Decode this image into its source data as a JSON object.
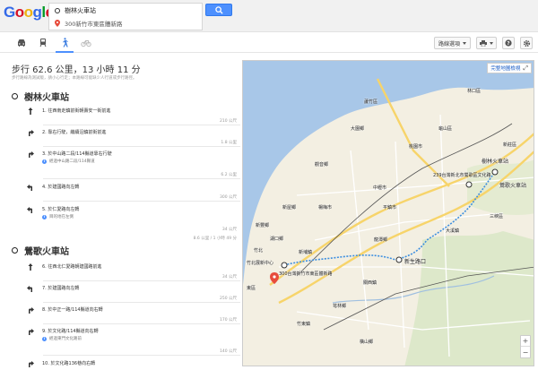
{
  "app": {
    "logo_text": "Google"
  },
  "directions": {
    "origin": "樹林火車站",
    "destination": "300新竹市東區體新路",
    "search_icon": "search-icon"
  },
  "modes": [
    {
      "name": "car-icon",
      "active": false
    },
    {
      "name": "transit-icon",
      "active": false
    },
    {
      "name": "walk-icon",
      "active": true
    },
    {
      "name": "bike-icon",
      "active": false
    }
  ],
  "toolbar": {
    "route_options_label": "路線選項",
    "print_icon": "print-icon",
    "help_icon": "help-icon",
    "settings_icon": "gear-icon"
  },
  "summary": {
    "title": "步行 62.6 公里，13 小時 11 分",
    "note": "步行路線為測試版，請小心行走；本路線可能缺少人行道或步行路徑。"
  },
  "places": [
    {
      "name": "樹林火車站"
    },
    {
      "name": "鶯歌火車站"
    }
  ],
  "group1_steps": [
    {
      "num": "1.",
      "text": "往西南走鎮前街朝壽安一街前進",
      "sub": "",
      "dist": "210 公尺"
    },
    {
      "num": "2.",
      "text": "靠右行駛，繼續沿鎮前街前進",
      "sub": "",
      "dist": "1.8 公里"
    },
    {
      "num": "3.",
      "text": "於中山路二段/114縣道靠右行駛",
      "sub": "經過中山路二段/114縣道",
      "dist": "6.2 公里"
    },
    {
      "num": "4.",
      "text": "於建國路向左轉",
      "sub": "",
      "dist": "300 公尺"
    },
    {
      "num": "5.",
      "text": "於仁愛路向左轉",
      "sub": "目的地在左側",
      "dist": "34 公尺"
    }
  ],
  "group1_total": "8.6 公里 / 1 小時 49 分",
  "group2_steps": [
    {
      "num": "6.",
      "text": "往西北仁愛路朝建國路前進",
      "sub": "",
      "dist": "34 公尺"
    },
    {
      "num": "7.",
      "text": "於建國路向左轉",
      "sub": "",
      "dist": "250 公尺"
    },
    {
      "num": "8.",
      "text": "於中正一路/114縣道向右轉",
      "sub": "",
      "dist": "170 公尺"
    },
    {
      "num": "9.",
      "text": "於文化路/114縣道向右轉",
      "sub": "經過東門文化路前",
      "dist": "140 公尺"
    },
    {
      "num": "10.",
      "text": "於文化路136巷向右轉",
      "sub": "",
      "dist": ""
    }
  ],
  "map": {
    "full_map_label": "完整地圖檢視",
    "labels": [
      "林口區",
      "蘆竹區",
      "新莊區",
      "大園鄉",
      "桃園市",
      "龜山區",
      "樹林火車站",
      "239台灣新北市鶯歌區文化路",
      "鶯歌火車站",
      "中壢市",
      "平鎮市",
      "楊梅市",
      "龍潭鄉",
      "大溪鎮",
      "新生路口",
      "竹北展新中心",
      "300台灣新竹市東區體新路",
      "東區",
      "竹東鎮",
      "新埔鎮",
      "關西鎮",
      "三峽區",
      "觀音鄉",
      "新屋鄉",
      "湖口鄉",
      "竹北",
      "新豐鄉",
      "芎林鄉",
      "橫山鄉"
    ],
    "zoom_in": "+",
    "zoom_out": "−"
  },
  "colors": {
    "route": "#3d8fe0",
    "accent": "#4d90fe",
    "land": "#f3efe2",
    "sea": "#a8c7e8",
    "highway": "#f7d46a"
  }
}
